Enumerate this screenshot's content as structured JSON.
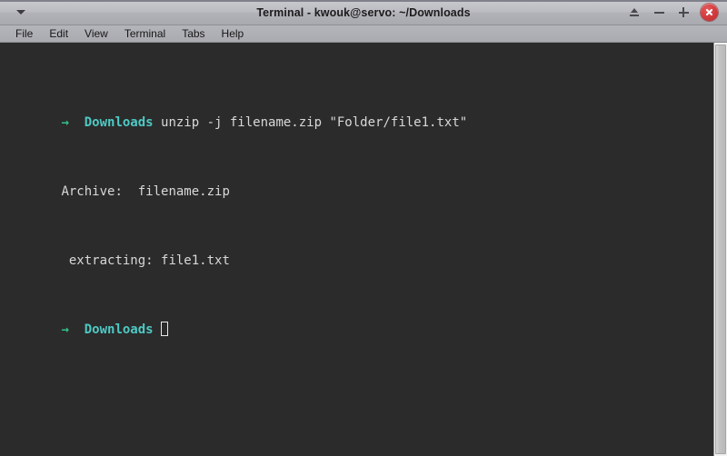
{
  "window": {
    "title": "Terminal - kwouk@servo: ~/Downloads",
    "menu_triangle_icon": "chevron-down-icon",
    "controls": {
      "shade_label": "▲",
      "minimize_label": "−",
      "maximize_label": "+",
      "close_label": "×"
    },
    "colors": {
      "titlebar_top": "#c8c9cd",
      "titlebar_bottom": "#a9aab0",
      "menubar": "#b0b1b6",
      "terminal_bg": "#2b2b2b",
      "terminal_fg": "#d8d8d8",
      "prompt_arrow": "#32c18a",
      "prompt_dir": "#4ec9c4",
      "close_button": "#d23b3d",
      "scrollbar_track": "#f2f2f2",
      "scrollbar_thumb": "#c2c2c2"
    }
  },
  "menubar": {
    "items": [
      {
        "label": "File"
      },
      {
        "label": "Edit"
      },
      {
        "label": "View"
      },
      {
        "label": "Terminal"
      },
      {
        "label": "Tabs"
      },
      {
        "label": "Help"
      }
    ]
  },
  "terminal": {
    "lines": [
      {
        "type": "prompt",
        "arrow": "→",
        "dir": "Downloads",
        "command": " unzip -j filename.zip \"Folder/file1.txt\""
      },
      {
        "type": "output",
        "text": "Archive:  filename.zip"
      },
      {
        "type": "output",
        "text": " extracting: file1.txt"
      },
      {
        "type": "prompt_cursor",
        "arrow": "→",
        "dir": "Downloads",
        "command": " "
      }
    ]
  },
  "scrollbar": {
    "position": "right",
    "thumb_fills_track": true
  }
}
